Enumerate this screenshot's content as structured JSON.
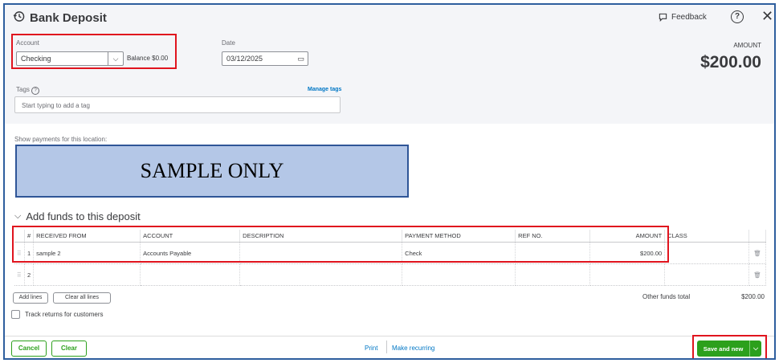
{
  "header": {
    "title": "Bank Deposit",
    "feedback_label": "Feedback",
    "help_label": "?",
    "close_label": "✕"
  },
  "account": {
    "label": "Account",
    "value": "Checking",
    "balance": "Balance $0.00"
  },
  "date": {
    "label": "Date",
    "value": "03/12/2025"
  },
  "amount": {
    "label": "AMOUNT",
    "value": "$200.00"
  },
  "tags": {
    "label": "Tags",
    "manage_label": "Manage tags",
    "placeholder": "Start typing to add a tag"
  },
  "location": {
    "label": "Show payments for this location:",
    "sample_text": "SAMPLE ONLY"
  },
  "section": {
    "title": "Add funds to this deposit"
  },
  "table": {
    "columns": [
      "#",
      "RECEIVED FROM",
      "ACCOUNT",
      "DESCRIPTION",
      "PAYMENT METHOD",
      "REF NO.",
      "AMOUNT",
      "CLASS"
    ],
    "rows": [
      {
        "num": "1",
        "received_from": "sample 2",
        "account": "Accounts Payable",
        "description": "",
        "payment_method": "Check",
        "ref_no": "",
        "amount": "$200.00",
        "class": ""
      },
      {
        "num": "2",
        "received_from": "",
        "account": "",
        "description": "",
        "payment_method": "",
        "ref_no": "",
        "amount": "",
        "class": ""
      }
    ]
  },
  "actions": {
    "add_lines": "Add lines",
    "clear_all_lines": "Clear all lines",
    "track_returns": "Track returns for customers"
  },
  "totals": {
    "label": "Other funds total",
    "value": "$200.00"
  },
  "footer": {
    "cancel": "Cancel",
    "clear": "Clear",
    "print": "Print",
    "make_recurring": "Make recurring",
    "save_new": "Save and new"
  },
  "colors": {
    "accent_green": "#2ca01c",
    "link_blue": "#0077c5",
    "highlight_red": "#e0141e",
    "sample_fill": "#b4c7e7"
  }
}
